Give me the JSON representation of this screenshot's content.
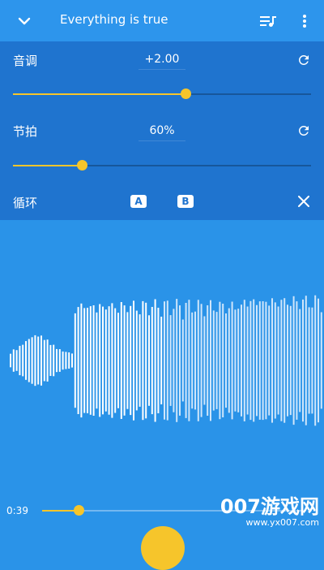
{
  "header": {
    "title": "Everything is true",
    "icons": [
      "chevron-down-icon",
      "playlist-icon",
      "more-vert-icon"
    ]
  },
  "pitch": {
    "label": "音调",
    "value": "+2.00",
    "level_percent": 58
  },
  "tempo": {
    "label": "节拍",
    "value": "60%",
    "level_percent": 23
  },
  "loop": {
    "label": "循环",
    "a_label": "A",
    "b_label": "B"
  },
  "player": {
    "time": "0:39",
    "progress_percent": 14
  },
  "watermark": {
    "line1": "007游戏网",
    "line2": "www.yx007.com"
  },
  "colors": {
    "accent": "#f6c52b",
    "background": "#2a93e8",
    "panel": "#1f74cf"
  }
}
